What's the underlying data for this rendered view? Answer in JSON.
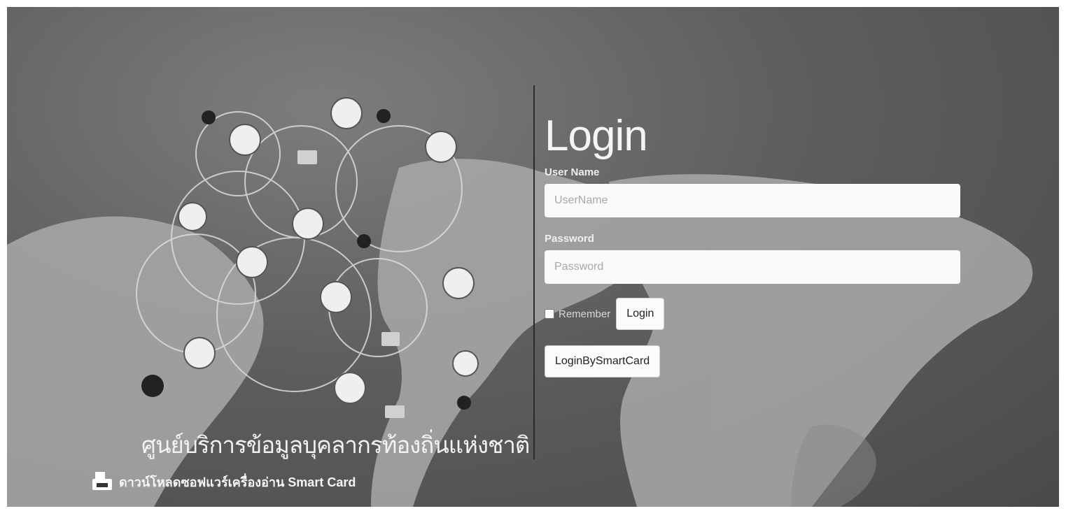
{
  "login": {
    "title": "Login",
    "username_label": "User Name",
    "username_placeholder": "UserName",
    "password_label": "Password",
    "password_placeholder": "Password",
    "remember_label": "Remember",
    "login_button": "Login",
    "smartcard_button": "LoginBySmartCard"
  },
  "branding": {
    "organization_name": "ศูนย์บริการข้อมูลบุคลากรท้องถิ่นแห่งชาติ",
    "download_link": "ดาวน์โหลดซอฟแวร์เครื่องอ่าน Smart Card",
    "download_icon": "card-reader-download-icon"
  }
}
